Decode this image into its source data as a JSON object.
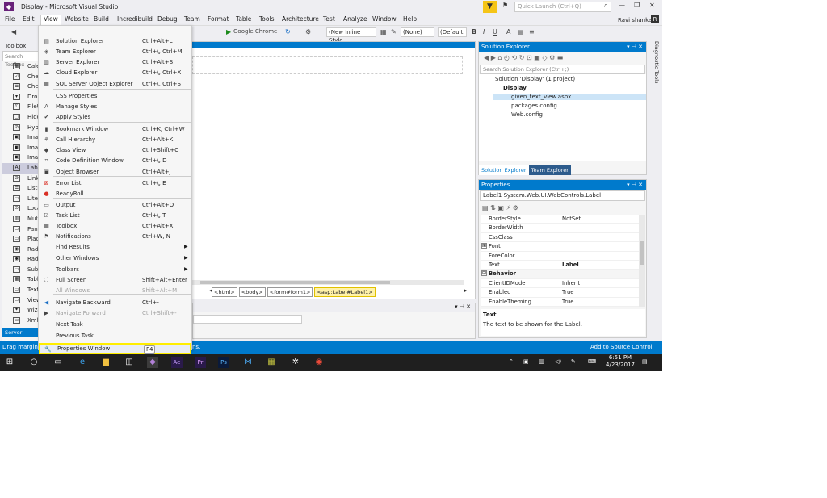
{
  "window": {
    "title": "Display - Microsoft Visual Studio",
    "quick_launch_placeholder": "Quick Launch (Ctrl+Q)",
    "user": "Ravi shankar"
  },
  "menubar": [
    "File",
    "Edit",
    "View",
    "Website",
    "Build",
    "Incredibuild",
    "Debug",
    "Team",
    "Format",
    "Table",
    "Tools",
    "Architecture",
    "Test",
    "Analyze",
    "Window",
    "Help"
  ],
  "toolbar": {
    "browser": "Google Chrome",
    "style": "(New Inline Style",
    "none": "(None)",
    "default": "(Default"
  },
  "toolbox": {
    "title": "Toolbox",
    "search": "Search Toolbox",
    "items": [
      "Calendar",
      "CheckBox",
      "CheckBoxList",
      "DropDownList",
      "FileUpload",
      "HiddenField",
      "HyperLink",
      "Image",
      "ImageButton",
      "ImageMap",
      "Label",
      "LinkButton",
      "ListBox",
      "Literal",
      "Localize",
      "MultiView",
      "Panel",
      "PlaceHolder",
      "RadioButton",
      "RadioButtonList",
      "Substitution",
      "Table",
      "TextBox",
      "View",
      "Wizard",
      "Xml"
    ],
    "server_explorer": "Server Explorer"
  },
  "breadcrumbs": [
    "<html>",
    "<body>",
    "<form#form1>",
    "<asp:Label#Label1>"
  ],
  "view_menu": [
    {
      "label": "Solution Explorer",
      "shortcut": "Ctrl+Alt+L",
      "icon": "solution-explorer-icon"
    },
    {
      "label": "Team Explorer",
      "shortcut": "Ctrl+\\, Ctrl+M",
      "icon": "team-explorer-icon"
    },
    {
      "label": "Server Explorer",
      "shortcut": "Ctrl+Alt+S",
      "icon": "server-explorer-icon"
    },
    {
      "label": "Cloud Explorer",
      "shortcut": "Ctrl+\\, Ctrl+X",
      "icon": "cloud-icon"
    },
    {
      "label": "SQL Server Object Explorer",
      "shortcut": "Ctrl+\\, Ctrl+S",
      "icon": "database-icon"
    },
    {
      "label": "CSS Properties",
      "shortcut": "",
      "icon": ""
    },
    {
      "label": "Manage Styles",
      "shortcut": "",
      "icon": "styles-icon"
    },
    {
      "label": "Apply Styles",
      "shortcut": "",
      "icon": "check-icon"
    },
    {
      "label": "Bookmark Window",
      "shortcut": "Ctrl+K, Ctrl+W",
      "icon": "bookmark-icon"
    },
    {
      "label": "Call Hierarchy",
      "shortcut": "Ctrl+Alt+K",
      "icon": "call-hierarchy-icon"
    },
    {
      "label": "Class View",
      "shortcut": "Ctrl+Shift+C",
      "icon": "class-view-icon"
    },
    {
      "label": "Code Definition Window",
      "shortcut": "Ctrl+\\, D",
      "icon": "code-definition-icon"
    },
    {
      "label": "Object Browser",
      "shortcut": "Ctrl+Alt+J",
      "icon": "object-browser-icon"
    },
    {
      "label": "Error List",
      "shortcut": "Ctrl+\\, E",
      "icon": "error-list-icon"
    },
    {
      "label": "ReadyRoll",
      "shortcut": "",
      "icon": "readyroll-icon"
    },
    {
      "label": "Output",
      "shortcut": "Ctrl+Alt+O",
      "icon": "output-icon"
    },
    {
      "label": "Task List",
      "shortcut": "Ctrl+\\, T",
      "icon": "task-list-icon"
    },
    {
      "label": "Toolbox",
      "shortcut": "Ctrl+Alt+X",
      "icon": "toolbox-icon"
    },
    {
      "label": "Notifications",
      "shortcut": "Ctrl+W, N",
      "icon": "notifications-icon"
    },
    {
      "label": "Find Results",
      "shortcut": "",
      "icon": "",
      "submenu": true
    },
    {
      "label": "Other Windows",
      "shortcut": "",
      "icon": "",
      "submenu": true
    },
    {
      "label": "Toolbars",
      "shortcut": "",
      "icon": "",
      "submenu": true
    },
    {
      "label": "Full Screen",
      "shortcut": "Shift+Alt+Enter",
      "icon": "full-screen-icon"
    },
    {
      "label": "All Windows",
      "shortcut": "Shift+Alt+M",
      "icon": "",
      "disabled": true
    },
    {
      "label": "Navigate Backward",
      "shortcut": "Ctrl+-",
      "icon": "navigate-back-icon"
    },
    {
      "label": "Navigate Forward",
      "shortcut": "Ctrl+Shift+-",
      "icon": "navigate-forward-icon",
      "disabled": true
    },
    {
      "label": "Next Task",
      "shortcut": "",
      "icon": ""
    },
    {
      "label": "Previous Task",
      "shortcut": "",
      "icon": ""
    },
    {
      "label": "Properties Window",
      "shortcut": "F4",
      "icon": "wrench-icon",
      "highlighted": true
    }
  ],
  "solution_explorer": {
    "title": "Solution Explorer",
    "search": "Search Solution Explorer (Ctrl+;)",
    "tree": [
      "Solution 'Display' (1 project)",
      "Display",
      "given_text_view.aspx",
      "packages.config",
      "Web.config"
    ],
    "tabs": [
      "Solution Explorer",
      "Team Explorer"
    ]
  },
  "properties": {
    "title": "Properties",
    "object": "Label1  System.Web.UI.WebControls.Label",
    "rows": [
      {
        "name": "BorderStyle",
        "value": "NotSet"
      },
      {
        "name": "BorderWidth",
        "value": ""
      },
      {
        "name": "CssClass",
        "value": ""
      },
      {
        "name": "Font",
        "value": "",
        "expand": "⊞"
      },
      {
        "name": "ForeColor",
        "value": ""
      },
      {
        "name": "Text",
        "value": "Label",
        "bold": true
      },
      {
        "name": "Behavior",
        "value": "",
        "category": true,
        "expand": "⊟"
      },
      {
        "name": "ClientIDMode",
        "value": "Inherit"
      },
      {
        "name": "Enabled",
        "value": "True"
      },
      {
        "name": "EnableTheming",
        "value": "True"
      }
    ],
    "desc_title": "Text",
    "desc_text": "The text to be shown for the Label."
  },
  "diagnostic_tools": "Diagnostic Tools",
  "status": {
    "left": "Drag margin h",
    "left_tail": "ns.",
    "right": "Add to Source Control"
  },
  "taskbar": {
    "time": "6:51 PM",
    "date": "4/23/2017"
  }
}
